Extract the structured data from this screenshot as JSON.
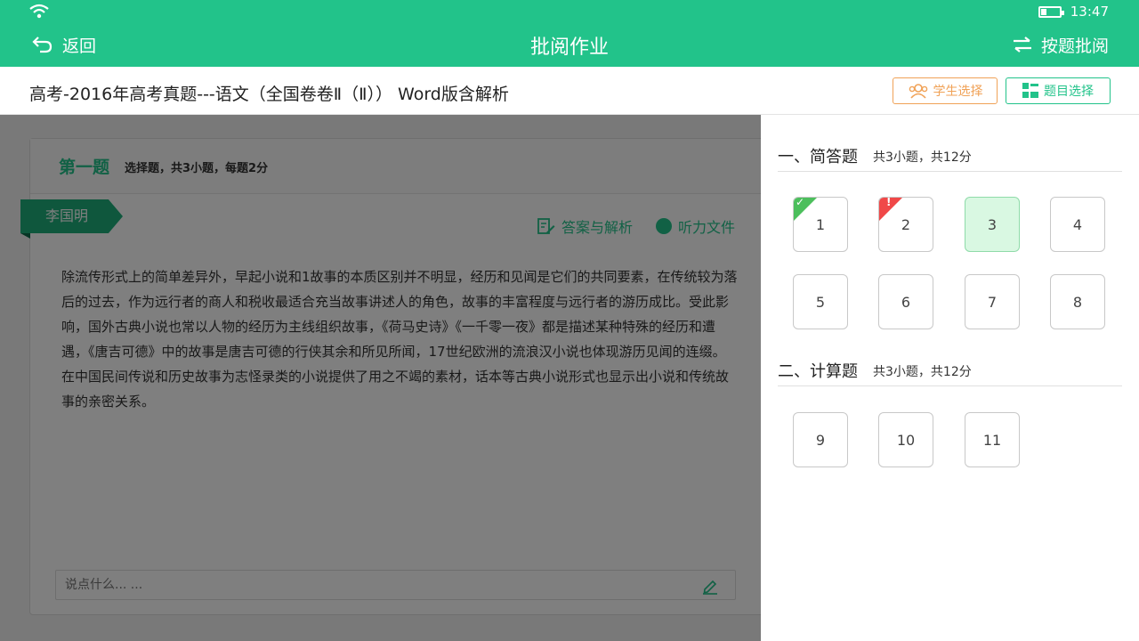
{
  "status": {
    "time": "13:47",
    "wifi_icon": "wifi-icon",
    "battery_icon": "battery-icon"
  },
  "header": {
    "back_label": "返回",
    "title": "批阅作业",
    "mode_label": "按题批阅",
    "color": "#22c38a"
  },
  "subheader": {
    "doc_title": "高考-2016年高考真题---语文（全国卷卷Ⅱ（Ⅱ）） Word版含解析",
    "student_select_label": "学生选择",
    "question_select_label": "题目选择"
  },
  "question": {
    "title": "第一题",
    "desc": "选择题，共3小题，每题2分",
    "student_name": "李国明",
    "answer_link": "答案与解析",
    "audio_link": "听力文件",
    "passage": "除流传形式上的简单差异外，早起小说和1故事的本质区别并不明显，经历和见闻是它们的共同要素，在传统较为落后的过去，作为远行者的商人和税收最适合充当故事讲述人的角色，故事的丰富程度与远行者的游历成比。受此影响，国外古典小说也常以人物的经历为主线组织故事，《荷马史诗》《一千零一夜》都是描述某种特殊的经历和遭遇，《唐吉可德》中的故事是唐吉可德的行侠其余和所见所闻，17世纪欧洲的流浪汉小说也体现游历见闻的连缀。在中国民间传说和历史故事为志怪录类的小说提供了用之不竭的素材，话本等古典小说形式也显示出小说和传统故事的亲密关系。",
    "comment_placeholder": "说点什么... ..."
  },
  "panel": {
    "sections": [
      {
        "name": "一、简答题",
        "meta": "共3小题，共12分",
        "items": [
          {
            "label": "1",
            "state": "correct"
          },
          {
            "label": "2",
            "state": "wrong"
          },
          {
            "label": "3",
            "state": "active"
          },
          {
            "label": "4",
            "state": "normal"
          },
          {
            "label": "5",
            "state": "normal"
          },
          {
            "label": "6",
            "state": "normal"
          },
          {
            "label": "7",
            "state": "normal"
          },
          {
            "label": "8",
            "state": "normal"
          }
        ]
      },
      {
        "name": "二、计算题",
        "meta": "共3小题，共12分",
        "items": [
          {
            "label": "9",
            "state": "normal"
          },
          {
            "label": "10",
            "state": "normal"
          },
          {
            "label": "11",
            "state": "normal"
          }
        ]
      }
    ],
    "colors": {
      "correct": "#4cbf5c",
      "wrong": "#f04848",
      "active": "#d9f8e2"
    }
  }
}
